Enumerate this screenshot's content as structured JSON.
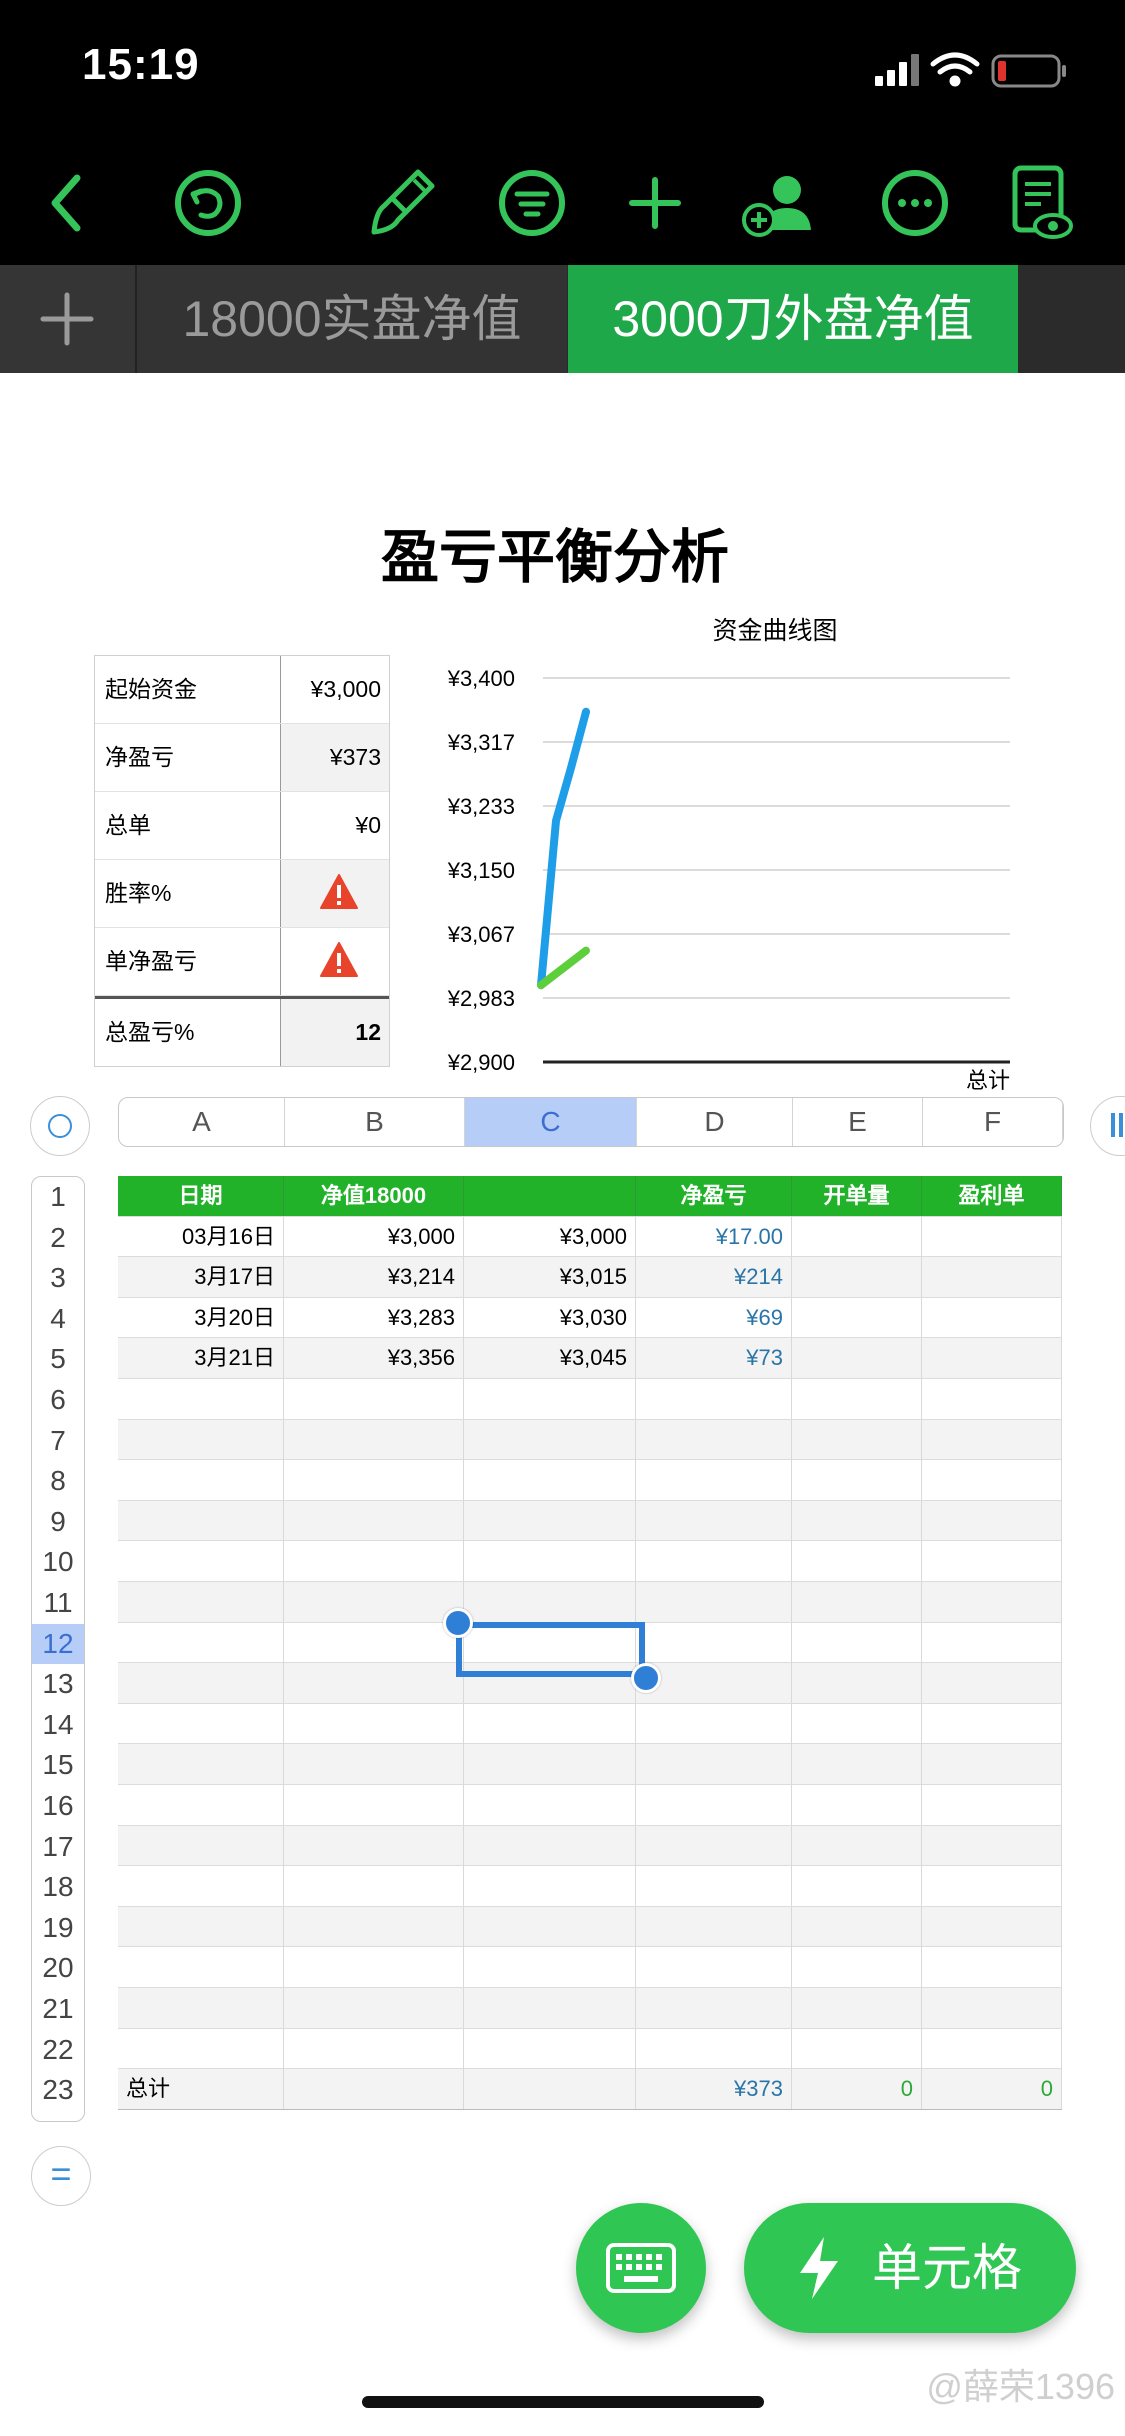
{
  "status": {
    "time": "15:19"
  },
  "tabs": [
    {
      "label": "18000实盘净值"
    },
    {
      "label": "3000刀外盘净值"
    }
  ],
  "sheet": {
    "title": "盈亏平衡分析"
  },
  "summary": [
    {
      "label": "起始资金",
      "value": "¥3,000"
    },
    {
      "label": "净盈亏",
      "value": "¥373"
    },
    {
      "label": "总单",
      "value": "¥0"
    },
    {
      "label": "胜率%",
      "value": "",
      "icon": "warning-icon"
    },
    {
      "label": "单净盈亏",
      "value": "",
      "icon": "warning-icon"
    },
    {
      "label": "总盈亏%",
      "value": "12"
    }
  ],
  "chart_data": {
    "type": "line",
    "title": "资金曲线图",
    "y_ticks": [
      "¥3,400",
      "¥3,317",
      "¥3,233",
      "¥3,150",
      "¥3,067",
      "¥2,983",
      "¥2,900"
    ],
    "ylim": [
      2900,
      3400
    ],
    "x_label": "总计",
    "series": [
      {
        "color": "#1e9ee8",
        "values": [
          3000,
          3214,
          3283,
          3356
        ]
      },
      {
        "color": "#5ccf3a",
        "values": [
          3000,
          3015,
          3030,
          3045
        ]
      }
    ]
  },
  "columns": [
    "A",
    "B",
    "C",
    "D",
    "E",
    "F"
  ],
  "rows": [
    "1",
    "2",
    "3",
    "4",
    "5",
    "6",
    "7",
    "8",
    "9",
    "10",
    "11",
    "12",
    "13",
    "14",
    "15",
    "16",
    "17",
    "18",
    "19",
    "20",
    "21",
    "22",
    "23"
  ],
  "table": {
    "headers": [
      "日期",
      "净值18000",
      "",
      "净盈亏",
      "开单量",
      "盈利单"
    ],
    "data": [
      [
        "03月16日",
        "¥3,000",
        "¥3,000",
        "¥17.00",
        "",
        ""
      ],
      [
        "3月17日",
        "¥3,214",
        "¥3,015",
        "¥214",
        "",
        ""
      ],
      [
        "3月20日",
        "¥3,283",
        "¥3,030",
        "¥69",
        "",
        ""
      ],
      [
        "3月21日",
        "¥3,356",
        "¥3,045",
        "¥73",
        "",
        ""
      ]
    ],
    "footer": [
      "总计",
      "",
      "",
      "¥373",
      "0",
      "0"
    ]
  },
  "buttons": {
    "cell_label": "单元格"
  },
  "watermark": "@薛荣1396",
  "colors": {
    "accent": "#30c653",
    "tab_active": "#1fa84a",
    "header_green": "#22b22a",
    "selection": "#2f7fd6"
  }
}
